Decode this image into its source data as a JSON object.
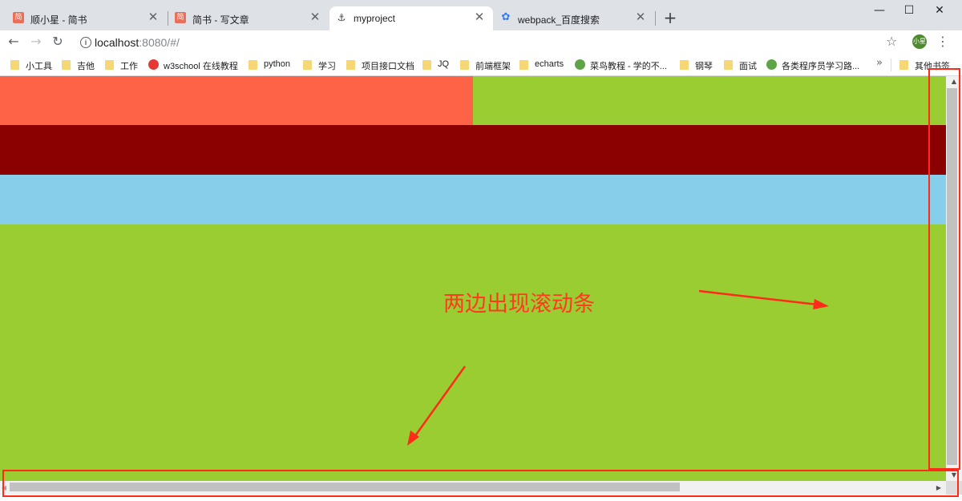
{
  "window": {
    "tabs": [
      {
        "title": "顺小星 - 简书",
        "favicon": "jianshu-icon",
        "favicon_text": "简",
        "favicon_color": "#ea6f5a",
        "active": false
      },
      {
        "title": "简书 - 写文章",
        "favicon": "jianshu-icon",
        "favicon_text": "简",
        "favicon_color": "#ea6f5a",
        "active": false
      },
      {
        "title": "myproject",
        "favicon": "project-icon",
        "favicon_text": "⚓",
        "favicon_color": "#ffffff",
        "active": true
      },
      {
        "title": "webpack_百度搜索",
        "favicon": "baidu-paw-icon",
        "favicon_text": "✿",
        "favicon_color": "#3178f6",
        "active": false
      }
    ],
    "new_tab_icon": "+",
    "controls": {
      "minimize": "—",
      "maximize": "☐",
      "close": "✕"
    }
  },
  "toolbar": {
    "back": "←",
    "forward": "→",
    "reload": "↻",
    "url_host": "localhost",
    "url_rest": ":8080/#/",
    "star": "☆",
    "avatar_text": "小星",
    "menu": "⋮"
  },
  "bookmarks": [
    {
      "label": "小工具",
      "icon": "folder-icon"
    },
    {
      "label": "吉他",
      "icon": "folder-icon"
    },
    {
      "label": "工作",
      "icon": "folder-icon"
    },
    {
      "label": "w3school 在线教程",
      "icon": "w3school-icon"
    },
    {
      "label": "python",
      "icon": "folder-icon"
    },
    {
      "label": "学习",
      "icon": "folder-icon"
    },
    {
      "label": "项目接口文档",
      "icon": "folder-icon"
    },
    {
      "label": "JQ",
      "icon": "folder-icon"
    },
    {
      "label": "前端框架",
      "icon": "folder-icon"
    },
    {
      "label": "echarts",
      "icon": "folder-icon"
    },
    {
      "label": "菜鸟教程 - 学的不...",
      "icon": "runoob-icon"
    },
    {
      "label": "钢琴",
      "icon": "folder-icon"
    },
    {
      "label": "面试",
      "icon": "folder-icon"
    },
    {
      "label": "各类程序员学习路...",
      "icon": "runoob-icon"
    },
    {
      "label": "其他书签",
      "icon": "folder-icon"
    }
  ],
  "bookmarks_more": "»",
  "page": {
    "colors": {
      "tomato": "#ff6347",
      "yellowgreen": "#9acd32",
      "darkred": "#8b0000",
      "skyblue": "#87ceeb"
    }
  },
  "scrollbars": {
    "vertical_thumb_fraction": 0.96,
    "horizontal_thumb_fraction": 0.71
  },
  "annotation": {
    "text": "两边出现滚动条",
    "color": "#ff3b1f"
  }
}
